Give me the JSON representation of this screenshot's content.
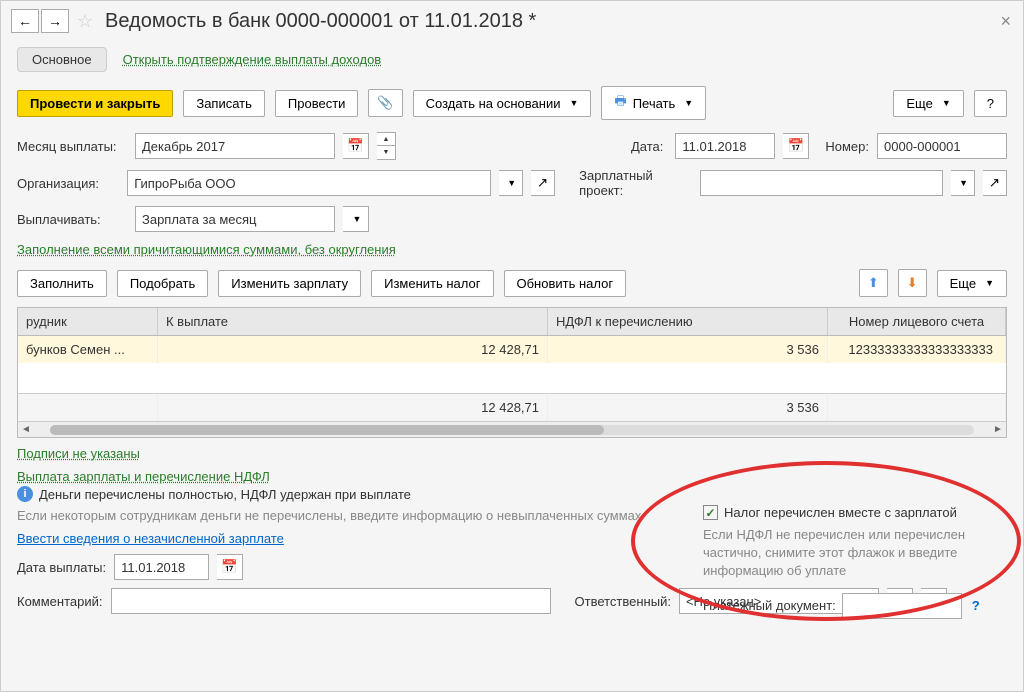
{
  "title": "Ведомость в банк 0000-000001 от 11.01.2018 *",
  "tabs": {
    "main": "Основное",
    "link": "Открыть подтверждение выплаты доходов"
  },
  "toolbar": {
    "submit": "Провести и закрыть",
    "save": "Записать",
    "post": "Провести",
    "create_based": "Создать на основании",
    "print": "Печать",
    "more": "Еще",
    "help": "?"
  },
  "fields": {
    "month_label": "Месяц выплаты:",
    "month_value": "Декабрь 2017",
    "date_label": "Дата:",
    "date_value": "11.01.2018",
    "number_label": "Номер:",
    "number_value": "0000-000001",
    "org_label": "Организация:",
    "org_value": "ГипроРыба ООО",
    "project_label": "Зарплатный проект:",
    "pay_label": "Выплачивать:",
    "pay_value": "Зарплата за месяц"
  },
  "fill_link": "Заполнение всеми причитающимися суммами, без округления",
  "table_toolbar": {
    "fill": "Заполнить",
    "select": "Подобрать",
    "edit_salary": "Изменить зарплату",
    "edit_tax": "Изменить налог",
    "update_tax": "Обновить налог",
    "more": "Еще"
  },
  "table": {
    "headers": {
      "employee": "рудник",
      "to_pay": "К выплате",
      "ndfl": "НДФЛ к перечислению",
      "account": "Номер лицевого счета"
    },
    "rows": [
      {
        "employee": "бунков Семен ...",
        "to_pay": "12 428,71",
        "ndfl": "3 536",
        "account": "12333333333333333333"
      }
    ],
    "totals": {
      "to_pay": "12 428,71",
      "ndfl": "3 536"
    }
  },
  "footer": {
    "signatures": "Подписи не указаны",
    "payment_ndfl": "Выплата зарплаты и перечисление НДФЛ",
    "money_info": "Деньги перечислены полностью, НДФЛ удержан при выплате",
    "hint1": "Если некоторым сотрудникам деньги не перечислены, введите информацию о невыплаченных суммах",
    "enter_info": "Ввести сведения о незачисленной зарплате",
    "tax_paid": "Налог перечислен вместе с зарплатой",
    "hint2": "Если НДФЛ не перечислен или перечислен частично, снимите этот флажок и введите информацию об уплате",
    "pay_doc_label": "Платежный документ:",
    "pay_date_label": "Дата выплаты:",
    "pay_date_value": "11.01.2018",
    "comment_label": "Комментарий:",
    "responsible_label": "Ответственный:",
    "responsible_value": "<Не указан>"
  }
}
